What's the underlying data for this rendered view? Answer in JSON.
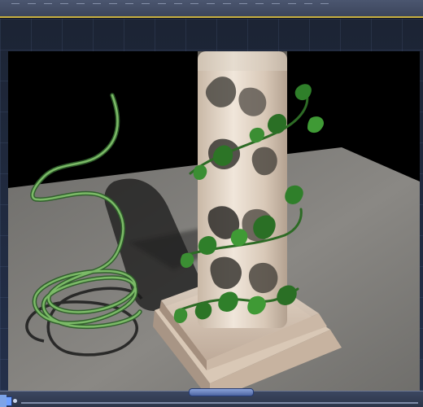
{
  "window": {
    "title": ""
  },
  "viewport": {
    "name": "3D viewport",
    "objects": [
      "marble-column",
      "ivy-vine",
      "green-spiral-vine",
      "ground-plane"
    ],
    "colors": {
      "background": "#000000",
      "floor": "#7c7a78",
      "column": "#e7d8c6",
      "vine": "#4f8d3a",
      "leaf": "#2f7f2a"
    }
  },
  "controls": {
    "top_handle": "toolbar-handle",
    "bottom_handle": "timeline-handle"
  }
}
